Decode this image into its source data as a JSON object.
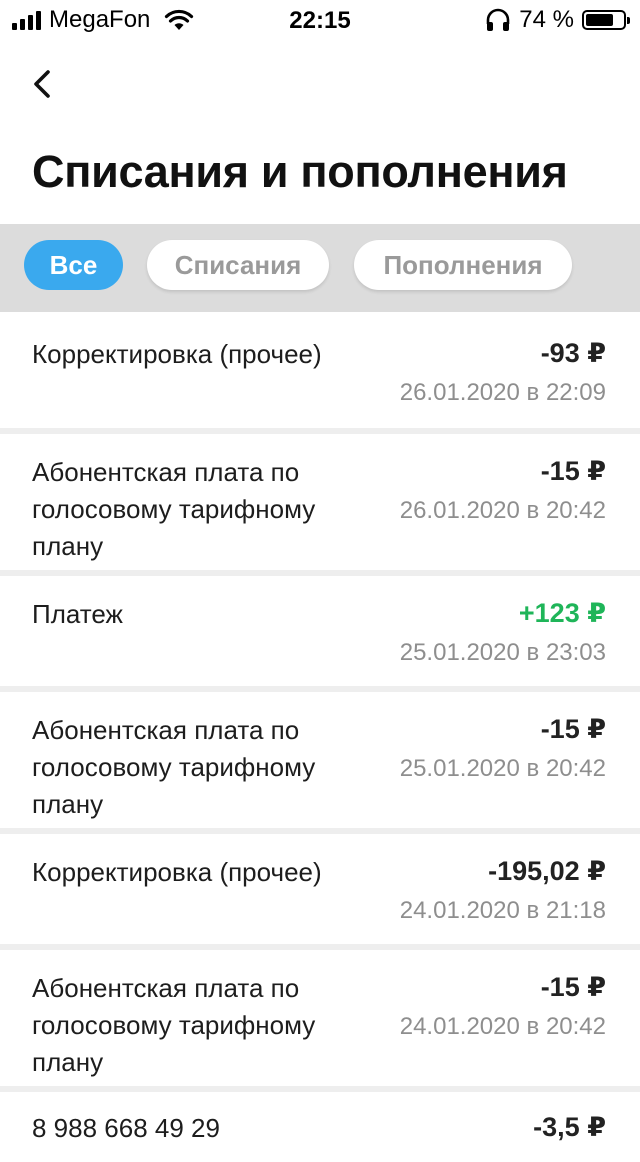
{
  "status_bar": {
    "carrier": "MegaFon",
    "time": "22:15",
    "battery": "74 %",
    "battery_level": 0.74
  },
  "page": {
    "title": "Списания и пополнения"
  },
  "filters": [
    {
      "label": "Все",
      "active": true
    },
    {
      "label": "Списания",
      "active": false
    },
    {
      "label": "Пополнения",
      "active": false
    }
  ],
  "transactions": [
    {
      "title": "Корректировка (прочее)",
      "amount": "-93 ₽",
      "date": "26.01.2020 в 22:09",
      "type": "debit"
    },
    {
      "title": "Абонентская плата по голосовому тарифному плану",
      "amount": "-15 ₽",
      "date": "26.01.2020 в 20:42",
      "type": "debit"
    },
    {
      "title": "Платеж",
      "amount": "+123 ₽",
      "date": "25.01.2020 в 23:03",
      "type": "credit"
    },
    {
      "title": "Абонентская плата по голосовому тарифному плану",
      "amount": "-15 ₽",
      "date": "25.01.2020 в 20:42",
      "type": "debit"
    },
    {
      "title": "Корректировка (прочее)",
      "amount": "-195,02 ₽",
      "date": "24.01.2020 в 21:18",
      "type": "debit"
    },
    {
      "title": "Абонентская плата по голосовому тарифному плану",
      "amount": "-15 ₽",
      "date": "24.01.2020 в 20:42",
      "type": "debit"
    },
    {
      "title": "8 988 668 49 29",
      "amount": "-3,5 ₽",
      "date": "",
      "type": "debit"
    }
  ],
  "colors": {
    "accent": "#3aa9ee",
    "credit": "#1fb559",
    "muted": "#8e8e8e",
    "filter_bar": "#dcdcdc"
  }
}
